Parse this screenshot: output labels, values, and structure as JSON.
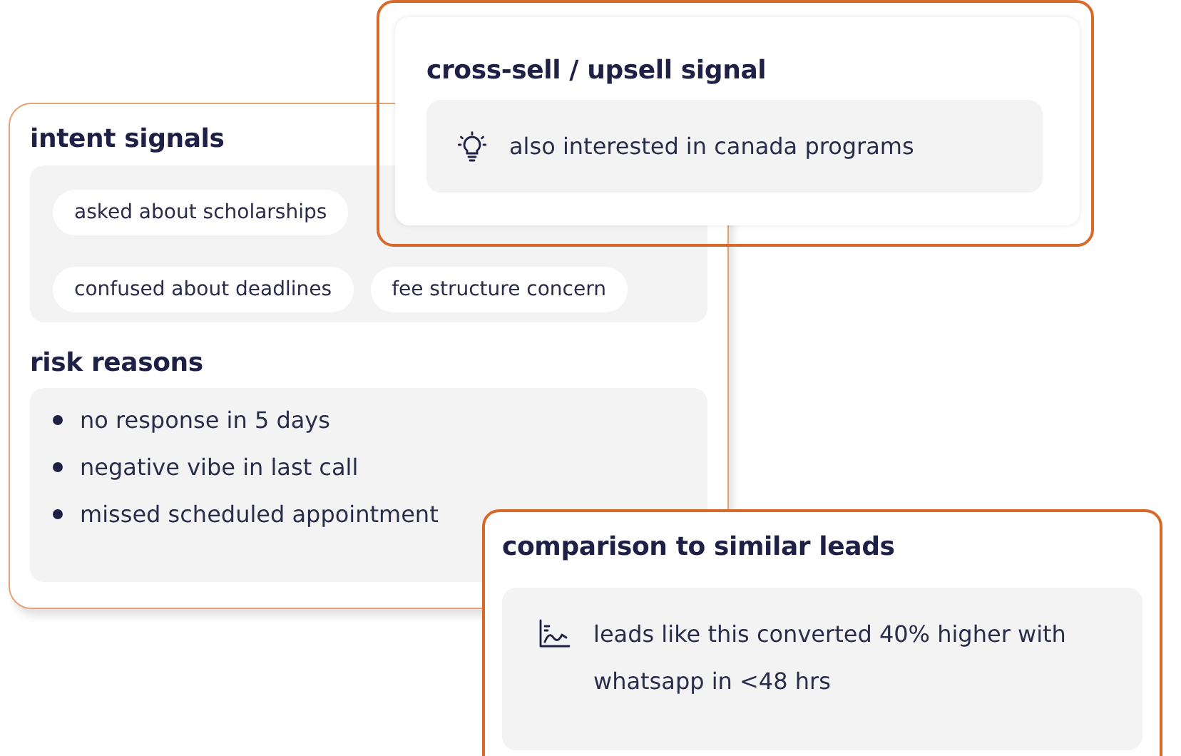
{
  "lead_card": {
    "intent_signals": {
      "title": "intent signals",
      "tags": [
        {
          "label": "asked about scholarships"
        },
        {
          "label": "confused about deadlines"
        },
        {
          "label": "fee structure concern"
        }
      ]
    },
    "risk_reasons": {
      "title": "risk reasons",
      "items": [
        "no response in 5 days",
        "negative vibe in last call",
        "missed scheduled appointment"
      ]
    }
  },
  "cross_sell": {
    "title": "cross-sell / upsell signal",
    "text": "also interested in canada programs"
  },
  "comparison": {
    "title": "comparison to similar leads",
    "text": "leads like this converted 40% higher with whatsapp in <48 hrs"
  }
}
